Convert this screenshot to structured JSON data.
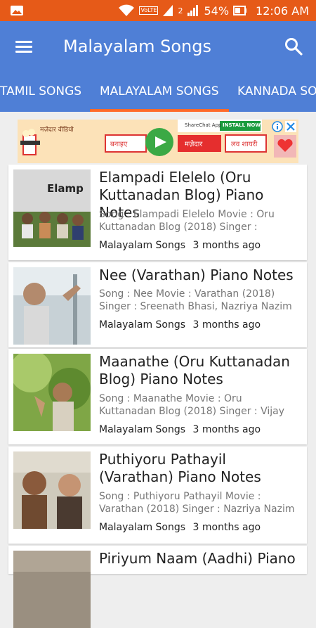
{
  "status": {
    "battery": "54%",
    "time": "12:06 AM",
    "network": "VoLTE",
    "sim_slot": "2"
  },
  "appbar": {
    "title": "Malayalam Songs"
  },
  "tabs": [
    {
      "label": "TAMIL SONGS"
    },
    {
      "label": "MALAYALAM SONGS"
    },
    {
      "label": "KANNADA SONGS"
    }
  ],
  "ad": {
    "left_text": "मज़ेदार वीडियो",
    "center_left": "बनाइए",
    "center_right": "मज़ेदार",
    "right_text": "लव शायरी",
    "brand": "ShareChat App",
    "install": "INSTALL NOW"
  },
  "posts": [
    {
      "title": "Elampadi Elelelo (Oru Kuttanadan Blog) Piano Notes",
      "desc": "Song : Elampadi Elelelo Movie : Oru Kuttanadan Blog (2018) Singer : Abhijith…",
      "category": "Malayalam Songs",
      "time": "3 months ago",
      "thumb_caption": "Elamp"
    },
    {
      "title": "Nee (Varathan) Piano Notes",
      "desc": "Song : Nee Movie : Varathan (2018) Singer : Sreenath Bhasi, Nazriya Nazim …",
      "category": "Malayalam Songs",
      "time": "3 months ago"
    },
    {
      "title": "Maanathe (Oru Kuttanadan Blog) Piano Notes",
      "desc": "Song : Maanathe Movie : Oru Kuttanadan Blog (2018) Singer : Vijay Yesudas & Mri…",
      "category": "Malayalam Songs",
      "time": "3 months ago"
    },
    {
      "title": "Puthiyoru Pathayil (Varathan) Piano Notes",
      "desc": "Song : Puthiyoru Pathayil Movie : Varathan (2018) Singer : Nazriya Nazim Puthiyoru …",
      "category": "Malayalam Songs",
      "time": "3 months ago"
    },
    {
      "title": "Piriyum Naam (Aadhi) Piano"
    }
  ],
  "colors": {
    "status_bar": "#e65a18",
    "app_bar": "#4f7fd6",
    "tab_indicator": "#ff6a2a"
  }
}
